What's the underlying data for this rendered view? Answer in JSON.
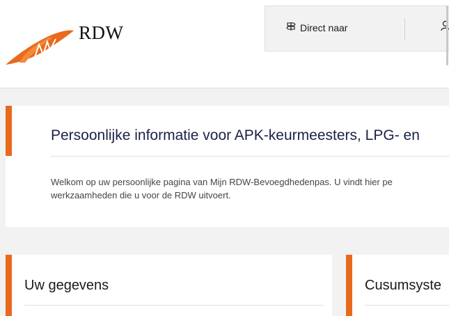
{
  "header": {
    "partial_title": "…g…",
    "logo_text": "RDW",
    "nav": {
      "direct_label": "Direct naar"
    }
  },
  "intro": {
    "title": "Persoonlijke informatie voor APK-keurmeesters, LPG- en",
    "text": "Welkom op uw persoonlijke pagina van Mijn RDW-Bevoegdhedenpas. U vindt hier pe werkzaamheden die u voor de RDW uitvoert."
  },
  "cards": [
    {
      "title": "Uw gegevens"
    },
    {
      "title": "Cusumsyste"
    }
  ],
  "colors": {
    "accent": "#e86a1c",
    "title_dark": "#1a2147"
  },
  "icons": {
    "direct": "signpost-icon",
    "user": "user-icon"
  }
}
